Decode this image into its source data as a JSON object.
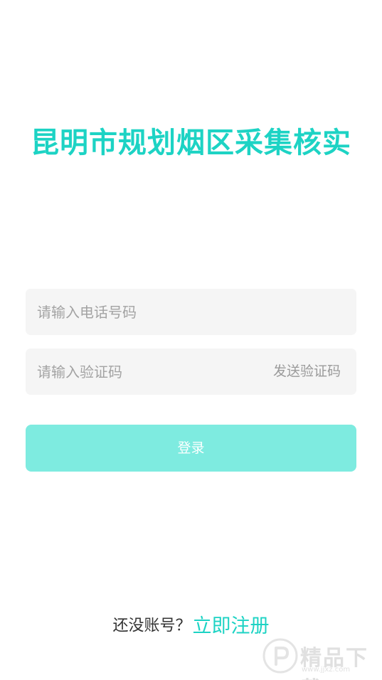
{
  "app": {
    "title": "昆明市规划烟区采集核实"
  },
  "login_form": {
    "phone_placeholder": "请输入电话号码",
    "phone_value": "",
    "code_placeholder": "请输入验证码",
    "code_value": "",
    "send_code_label": "发送验证码",
    "login_label": "登录"
  },
  "register": {
    "prompt": "还没账号？",
    "link_label": "立即注册"
  },
  "watermark": {
    "text": "精品下载",
    "url": "www.jjxz.com",
    "icon": "jingpin-logo-icon"
  },
  "colors": {
    "accent": "#1dd3c4",
    "button_bg": "#7eebe0",
    "field_bg": "#f5f5f5",
    "placeholder": "#a3a3a3"
  }
}
